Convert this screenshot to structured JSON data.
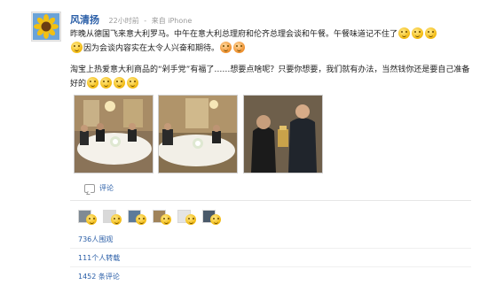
{
  "post": {
    "username": "风清扬",
    "time": "22小时前",
    "source": "来自 iPhone",
    "lines": [
      "昨晚从德国飞来意大利罗马。中午在意大利总理府和伦齐总理会谈和午餐。午餐味道记不住了",
      "因为会谈内容实在太令人兴奋和期待。",
      "淘宝上热爱意大利商品的“剁手党”有福了……想要点啥呢？只要你想要，我们就有办法，当然钱你还是要自己准备",
      "好的"
    ]
  },
  "comment_label": "评论",
  "stats": {
    "views": "736人围观",
    "reposts": "111个人转载",
    "comments": "1452 条评论"
  },
  "icons": {
    "avatar": "sunflower-avatar",
    "comment": "comment-bubble-icon",
    "emoji": "laughing-emoji-icon",
    "cry_emoji": "crying-emoji-icon"
  },
  "photos": [
    "dinner-table-photo-1",
    "dinner-table-photo-2",
    "handshake-photo"
  ]
}
